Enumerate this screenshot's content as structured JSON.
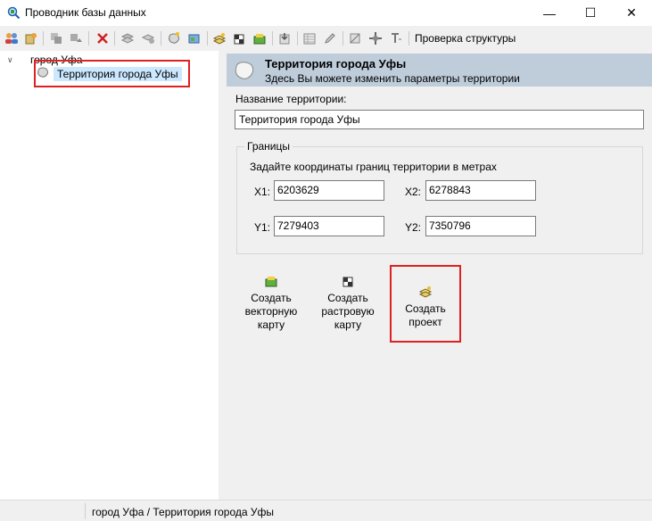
{
  "window": {
    "title": "Проводник базы данных",
    "minimize_glyph": "—",
    "maximize_glyph": "☐",
    "close_glyph": "✕"
  },
  "toolbar": {
    "check_structure_label": "Проверка структуры"
  },
  "tree": {
    "root_label": "город Уфа",
    "child_label": "Территория города Уфы"
  },
  "panel": {
    "title": "Территория города Уфы",
    "subtitle": "Здесь Вы можете изменить параметры территории",
    "name_label": "Название территории:",
    "name_value": "Территория города Уфы",
    "bounds": {
      "legend": "Границы",
      "hint": "Задайте координаты границ территории в метрах",
      "x1_label": "X1:",
      "x1_value": "6203629",
      "x2_label": "X2:",
      "x2_value": "6278843",
      "y1_label": "Y1:",
      "y1_value": "7279403",
      "y2_label": "Y2:",
      "y2_value": "7350796"
    },
    "actions": {
      "vector_map": [
        "Создать",
        "векторную",
        "карту"
      ],
      "raster_map": [
        "Создать",
        "растровую",
        "карту"
      ],
      "project": [
        "Создать",
        "проект"
      ]
    }
  },
  "status": {
    "breadcrumb": "город Уфа / Территория города Уфы"
  },
  "colors": {
    "highlight_red": "#e02020",
    "selection": "#cce8ff",
    "header_bg": "#bfcddb"
  }
}
